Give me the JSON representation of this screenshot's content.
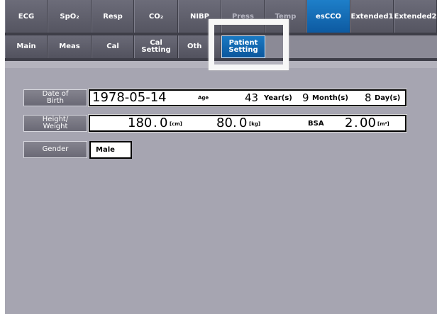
{
  "top_tabs": [
    {
      "label": "ECG",
      "state": "normal"
    },
    {
      "label": "SpO₂",
      "state": "normal"
    },
    {
      "label": "Resp",
      "state": "normal"
    },
    {
      "label": "CO₂",
      "state": "normal"
    },
    {
      "label": "NIBP",
      "state": "normal"
    },
    {
      "label": "Press",
      "state": "dim"
    },
    {
      "label": "Temp",
      "state": "dim"
    },
    {
      "label": "esCCO",
      "state": "active"
    },
    {
      "label": "Extended1",
      "state": "normal"
    },
    {
      "label": "Extended2",
      "state": "normal"
    }
  ],
  "sub_tabs": [
    {
      "label": "Main"
    },
    {
      "label": "Meas"
    },
    {
      "label": "Cal"
    },
    {
      "label": "Cal Setting"
    },
    {
      "label": "Oth"
    },
    {
      "label": "Patient Setting"
    }
  ],
  "birth": {
    "label": "Date of Birth",
    "date": "1978-05-14",
    "age_label": "Age",
    "years": "43",
    "years_unit": "Year(s)",
    "months": "9",
    "months_unit": "Month(s)",
    "days": "8",
    "days_unit": "Day(s)"
  },
  "body": {
    "label": "Height/ Weight",
    "height_int": "180",
    "height_dec": "0",
    "height_unit": "[cm]",
    "weight_int": "80",
    "weight_dec": "0",
    "weight_unit": "[kg]",
    "bsa_label": "BSA",
    "bsa_int": "2",
    "bsa_dec": "00",
    "bsa_unit": "[m²]"
  },
  "gender": {
    "label": "Gender",
    "value": "Male"
  },
  "colors": {
    "active_tab": "#0d5aa1",
    "background": "#a6a5b1",
    "tab_bar": "#4e4e5a"
  }
}
